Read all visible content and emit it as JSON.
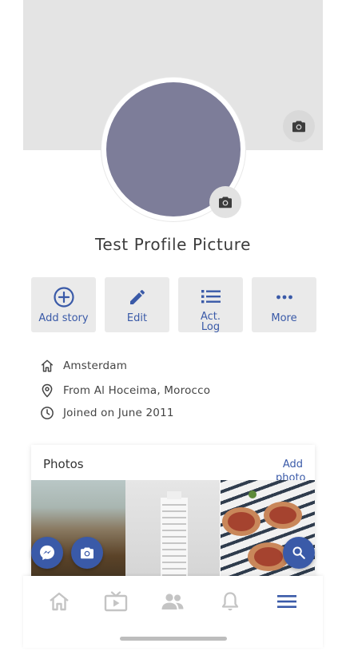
{
  "profile": {
    "name": "Test Profile Picture"
  },
  "actions": [
    {
      "label": "Add story",
      "icon": "add-circle-icon"
    },
    {
      "label": "Edit",
      "icon": "pencil-icon"
    },
    {
      "label": "Act. Log",
      "icon": "list-icon"
    },
    {
      "label": "More",
      "icon": "more-dots-icon"
    }
  ],
  "info": {
    "lives_in": "Amsterdam",
    "from": "From Al Hoceima, Morocco",
    "joined": "Joined on June 2011"
  },
  "photos": {
    "title": "Photos",
    "add_label": "Add photo"
  },
  "nav": {
    "items": [
      "home-icon",
      "watch-icon",
      "friends-icon",
      "notifications-icon",
      "menu-icon"
    ],
    "active": "menu-icon"
  },
  "colors": {
    "accent": "#3a5aa8",
    "avatar": "#7d7d99",
    "cover": "#e4e4e4",
    "nav_inactive": "#c4c4c4"
  }
}
